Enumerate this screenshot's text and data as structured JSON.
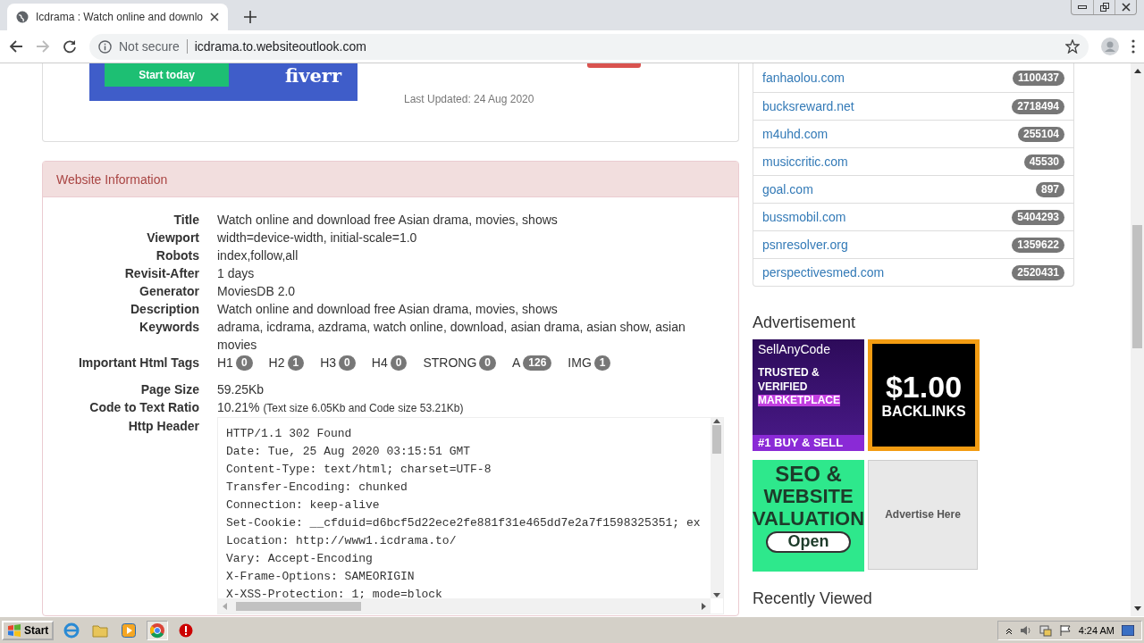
{
  "browser": {
    "tab": {
      "title": "Icdrama : Watch online and downlo",
      "selected": true
    },
    "security": "Not secure",
    "url": "icdrama.to.websiteoutlook.com"
  },
  "top_card": {
    "ad": {
      "button": "Start today",
      "brand": "fiverr"
    },
    "last_updated": "Last Updated: 24 Aug 2020"
  },
  "website_information": {
    "heading": "Website Information",
    "rows": [
      {
        "kind": "text",
        "label": "Title",
        "value": "Watch online and download free Asian drama, movies, shows"
      },
      {
        "kind": "text",
        "label": "Viewport",
        "value": "width=device-width, initial-scale=1.0"
      },
      {
        "kind": "text",
        "label": "Robots",
        "value": "index,follow,all"
      },
      {
        "kind": "text",
        "label": "Revisit-After",
        "value": "1 days"
      },
      {
        "kind": "text",
        "label": "Generator",
        "value": "MoviesDB 2.0"
      },
      {
        "kind": "text",
        "label": "Description",
        "value": "Watch online and download free Asian drama, movies, shows"
      },
      {
        "kind": "text",
        "label": "Keywords",
        "value": "adrama, icdrama, azdrama, watch online, download, asian drama, asian show, asian movies"
      },
      {
        "kind": "tags",
        "label": "Important Html Tags",
        "tags": [
          {
            "name": "H1",
            "count": "0"
          },
          {
            "name": "H2",
            "count": "1"
          },
          {
            "name": "H3",
            "count": "0"
          },
          {
            "name": "H4",
            "count": "0"
          },
          {
            "name": "STRONG",
            "count": "0"
          },
          {
            "name": "A",
            "count": "126"
          },
          {
            "name": "IMG",
            "count": "1"
          }
        ]
      },
      {
        "kind": "text",
        "label": "Page Size",
        "value": "59.25Kb"
      },
      {
        "kind": "text",
        "label": "Code to Text Ratio",
        "value": "10.21%",
        "note": "(Text size 6.05Kb and Code size 53.21Kb)"
      },
      {
        "kind": "header",
        "label": "Http Header",
        "lines": [
          "HTTP/1.1 302 Found",
          "Date: Tue, 25 Aug 2020 03:15:51 GMT",
          "Content-Type: text/html; charset=UTF-8",
          "Transfer-Encoding: chunked",
          "Connection: keep-alive",
          "Set-Cookie: __cfduid=d6bcf5d22ece2fe881f31e465dd7e2a7f1598325351; ex",
          "Location: http://www1.icdrama.to/",
          "Vary: Accept-Encoding",
          "X-Frame-Options: SAMEORIGIN",
          "X-XSS-Protection: 1; mode=block"
        ]
      }
    ]
  },
  "sidebar": {
    "sites": [
      {
        "domain": "fanhaolou.com",
        "rank": "1100437"
      },
      {
        "domain": "bucksreward.net",
        "rank": "2718494"
      },
      {
        "domain": "m4uhd.com",
        "rank": "255104"
      },
      {
        "domain": "musiccritic.com",
        "rank": "45530"
      },
      {
        "domain": "goal.com",
        "rank": "897"
      },
      {
        "domain": "bussmobil.com",
        "rank": "5404293"
      },
      {
        "domain": "psnresolver.org",
        "rank": "1359622"
      },
      {
        "domain": "perspectivesmed.com",
        "rank": "2520431"
      }
    ],
    "advertisement_heading": "Advertisement",
    "ads": [
      {
        "kind": "sellanycode",
        "lines": [
          "SellAnyCode",
          "TRUSTED &",
          "VERIFIED",
          "MARKETPLACE",
          "#1 BUY & SELL"
        ]
      },
      {
        "kind": "backlinks",
        "lines": [
          "$1.00",
          "BACKLINKS"
        ]
      },
      {
        "kind": "seo",
        "lines": [
          "SEO &",
          "WEBSITE",
          "VALUATION",
          "Open"
        ]
      },
      {
        "kind": "placeholder",
        "lines": [
          "Advertise Here"
        ]
      }
    ],
    "recently_viewed_heading": "Recently Viewed"
  },
  "taskbar": {
    "start": "Start",
    "clock": "4:24 AM"
  }
}
